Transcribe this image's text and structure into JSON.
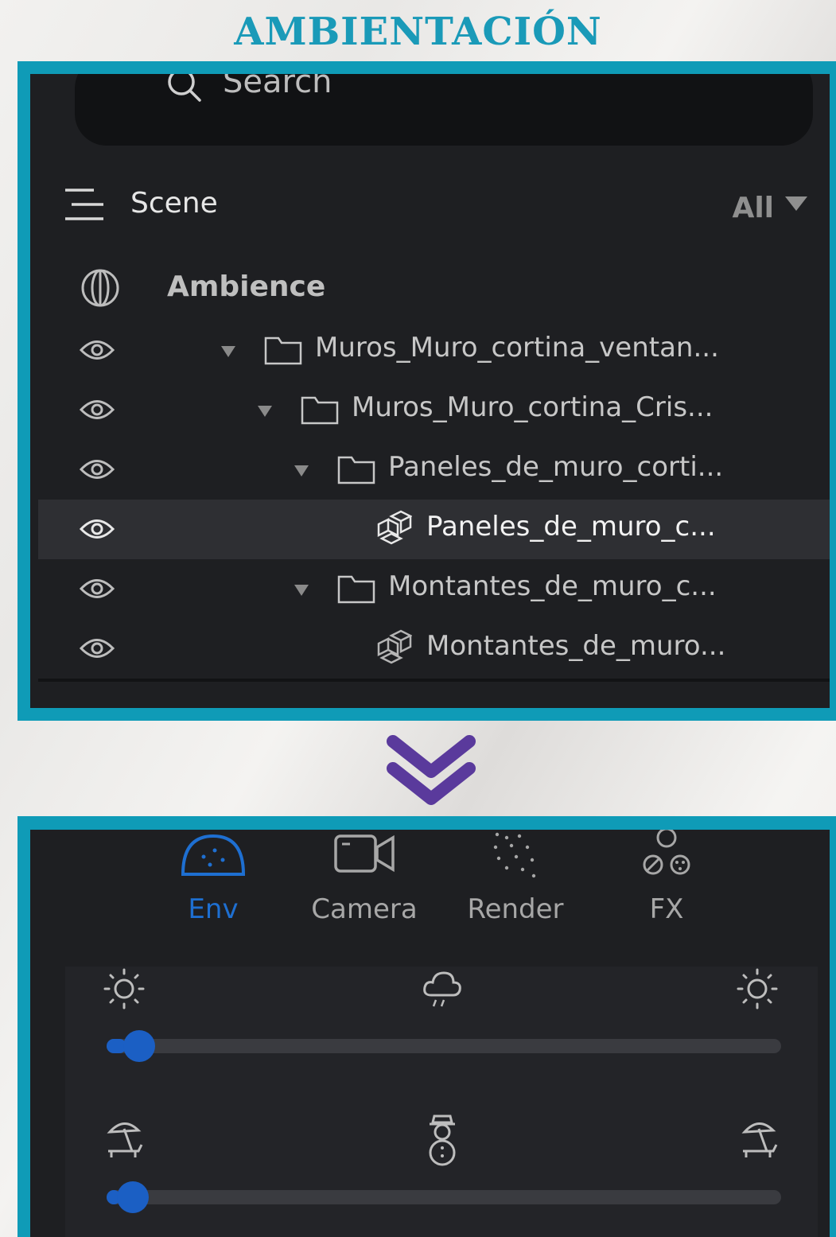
{
  "page_title": "AMBIENTACIÓN",
  "outliner": {
    "search": {
      "placeholder": "Search",
      "value": ""
    },
    "scene_label": "Scene",
    "filter_label": "All",
    "ambience_label": "Ambience",
    "rows": [
      {
        "label": "Muros_Muro_cortina_ventan...",
        "type": "folder",
        "icon": "folder-icon",
        "expanded": true,
        "selected": false
      },
      {
        "label": "Muros_Muro_cortina_Cris...",
        "type": "folder",
        "icon": "folder-icon",
        "expanded": true,
        "selected": false
      },
      {
        "label": "Paneles_de_muro_corti...",
        "type": "folder",
        "icon": "folder-icon",
        "expanded": true,
        "selected": false
      },
      {
        "label": "Paneles_de_muro_c...",
        "type": "mesh",
        "icon": "mesh-icon",
        "expanded": false,
        "selected": true
      },
      {
        "label": "Montantes_de_muro_c...",
        "type": "folder",
        "icon": "folder-icon",
        "expanded": true,
        "selected": false
      },
      {
        "label": "Montantes_de_muro...",
        "type": "mesh",
        "icon": "mesh-icon",
        "expanded": false,
        "selected": false
      }
    ]
  },
  "tabs": [
    {
      "label": "Env",
      "icon": "env-dome-icon",
      "active": true
    },
    {
      "label": "Camera",
      "icon": "camera-icon",
      "active": false
    },
    {
      "label": "Render",
      "icon": "render-dots-icon",
      "active": false
    },
    {
      "label": "FX",
      "icon": "fx-icon",
      "active": false
    }
  ],
  "env": {
    "weather_slider": {
      "left_icon": "sun-icon",
      "middle_icon": "cloud-storm-icon",
      "right_icon": "sun-icon",
      "value": 0.03
    },
    "temperature_slider": {
      "left_icon": "beach-umbrella-icon",
      "middle_icon": "snowman-icon",
      "right_icon": "beach-umbrella-icon",
      "value": 0.02
    }
  },
  "colors": {
    "frame": "#0f9bb7",
    "title": "#1a9ab8",
    "accent": "#1b5fc4",
    "panel": "#1e1f22",
    "chevron": "#5a3a9c"
  }
}
